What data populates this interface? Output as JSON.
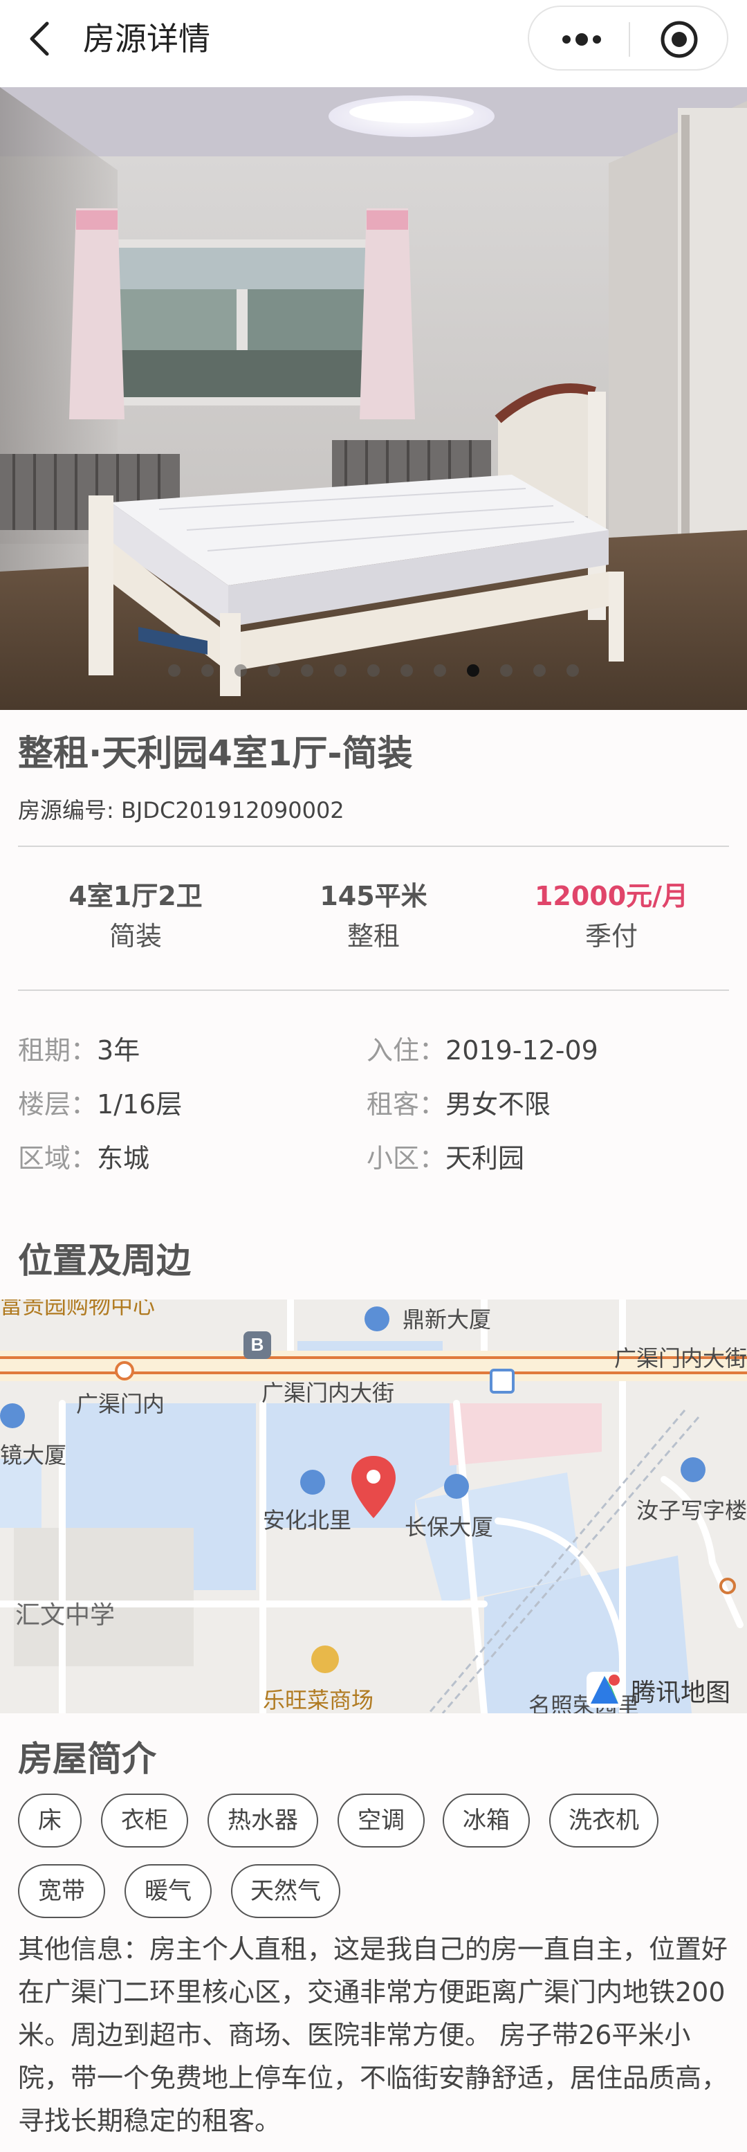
{
  "header": {
    "title": "房源详情"
  },
  "photo": {
    "total_slides": 13,
    "active_index": 9
  },
  "listing": {
    "title": "整租·天利园4室1厅-简装",
    "code_label": "房源编号:",
    "code": "BJDC201912090002"
  },
  "summary": [
    {
      "main": "4室1厅2卫",
      "sub": "简装"
    },
    {
      "main": "145平米",
      "sub": "整租"
    },
    {
      "main": "12000元/月",
      "sub": "季付"
    }
  ],
  "details": [
    {
      "label": "租期：",
      "value": "3年"
    },
    {
      "label": "入住：",
      "value": "2019-12-09"
    },
    {
      "label": "楼层：",
      "value": "1/16层"
    },
    {
      "label": "租客：",
      "value": "男女不限"
    },
    {
      "label": "区域：",
      "value": "东城"
    },
    {
      "label": "小区：",
      "value": "天利园"
    }
  ],
  "location": {
    "section_title": "位置及周边",
    "map_labels": {
      "mall": "富贵园购物中心",
      "dingxin": "鼎新大厦",
      "street_right": "广渠门内大街",
      "street_center": "广渠门内大街",
      "guangqumennei": "广渠门内",
      "jing_building": "镜大厦",
      "anhua": "安化北里",
      "changbao": "长保大厦",
      "ruzi": "汝子写字楼",
      "huiwen": "汇文中学",
      "lewang": "乐旺菜商场",
      "mingzhao": "名照荣园里",
      "provider": "腾讯地图",
      "bus_badge": "B"
    }
  },
  "intro": {
    "section_title": "房屋简介",
    "tags": [
      "床",
      "衣柜",
      "热水器",
      "空调",
      "冰箱",
      "洗衣机",
      "宽带",
      "暖气",
      "天然气"
    ],
    "description": "其他信息：房主个人直租，这是我自己的房一直自主，位置好在广渠门二环里核心区，交通非常方便距离广渠门内地铁200米。周边到超市、商场、医院非常方便。 房子带26平米小院，带一个免费地上停车位，不临街安静舒适，居住品质高，寻找长期稳定的租客。"
  }
}
